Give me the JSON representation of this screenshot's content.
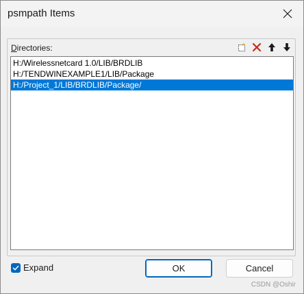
{
  "window": {
    "title": "psmpath Items"
  },
  "directories": {
    "label_first": "D",
    "label_rest": "irectories:",
    "toolbar": [
      {
        "icon": "new-icon"
      },
      {
        "icon": "delete-icon",
        "color": "#c42b1c"
      },
      {
        "icon": "arrow-up-icon"
      },
      {
        "icon": "arrow-down-icon"
      }
    ],
    "items": [
      {
        "text": "H:/Wirelessnetcard 1.0/LIB/BRDLIB",
        "selected": false
      },
      {
        "text": "H:/TENDWINEXAMPLE1/LIB/Package",
        "selected": false
      },
      {
        "text": "H:/Project_1/LIB/BRDLIB/Package/",
        "selected": true
      }
    ]
  },
  "expand": {
    "label": "Expand",
    "checked": true
  },
  "buttons": {
    "ok": "OK",
    "cancel": "Cancel"
  },
  "watermark": "CSDN @Oshir",
  "colors": {
    "selection": "#0078d7",
    "checkbox": "#0067c0",
    "delete": "#c42b1c"
  }
}
